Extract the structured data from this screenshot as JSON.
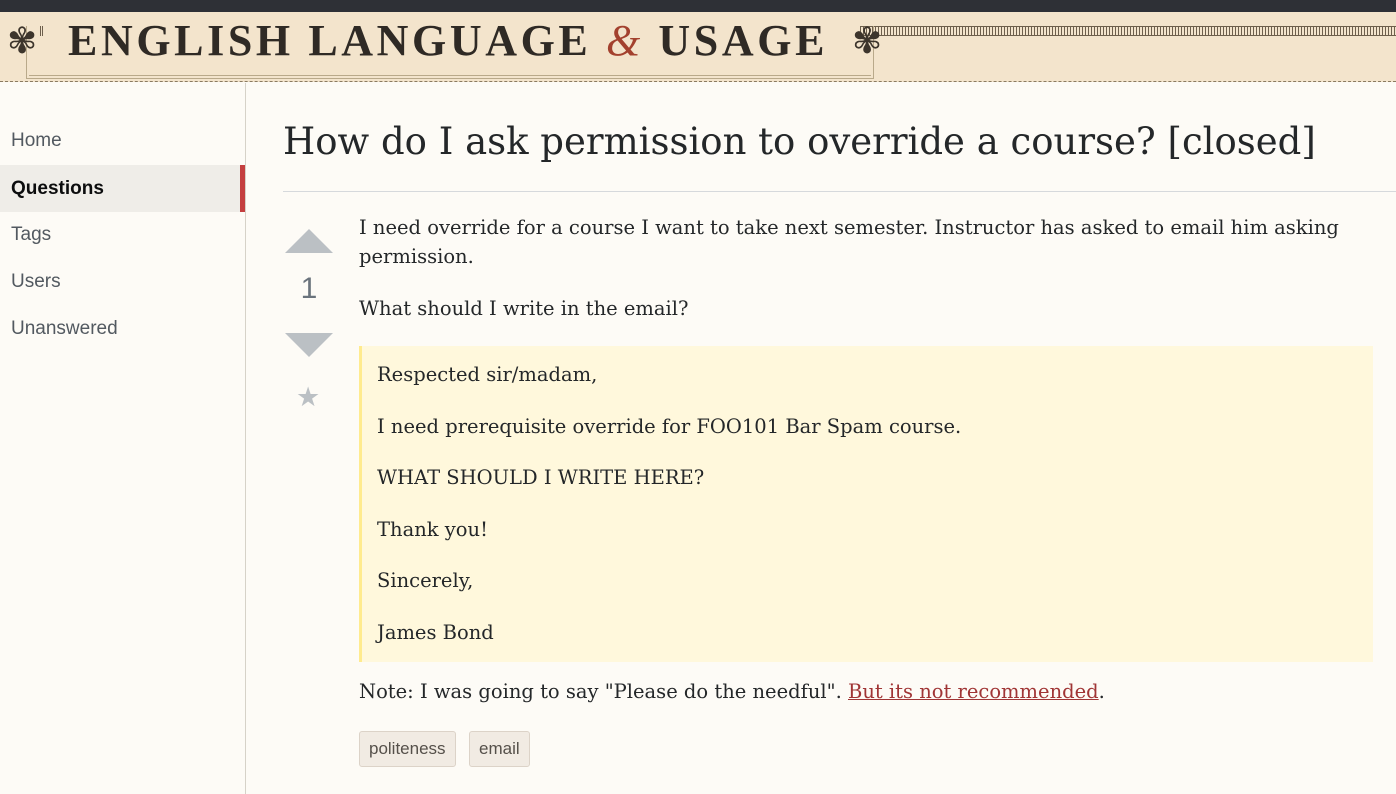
{
  "header": {
    "site_title_part1": "ENGLISH LANGUAGE",
    "site_title_amp": "&",
    "site_title_part2": "USAGE"
  },
  "sidebar": {
    "items": [
      {
        "label": "Home"
      },
      {
        "label": "Questions"
      },
      {
        "label": "Tags"
      },
      {
        "label": "Users"
      },
      {
        "label": "Unanswered"
      }
    ],
    "active": "Questions"
  },
  "question": {
    "title": "How do I ask permission to override a course? [closed]",
    "vote_count": "1",
    "body_p1": "I need override for a course I want to take next semester. Instructor has asked to email him asking permission.",
    "body_p2": "What should I write in the email?",
    "quote_lines": [
      "Respected sir/madam,",
      "I need prerequisite override for FOO101 Bar Spam course.",
      "WHAT SHOULD I WRITE HERE?",
      "Thank you!",
      "Sincerely,",
      "James Bond"
    ],
    "note_prefix": "Note: I was going to say \"Please do the needful\". ",
    "note_link": "But its not recommended",
    "note_suffix": ".",
    "tags": [
      "politeness",
      "email"
    ]
  },
  "icons": {
    "vote_up": "arrow-up-icon",
    "vote_down": "arrow-down-icon",
    "favorite": "star-icon",
    "ornament": "fleuron-icon"
  },
  "colors": {
    "masthead_bg": "#f3e4cc",
    "accent_red": "#c43f3f",
    "quote_bg": "#fff8dc",
    "link": "#a03535"
  }
}
